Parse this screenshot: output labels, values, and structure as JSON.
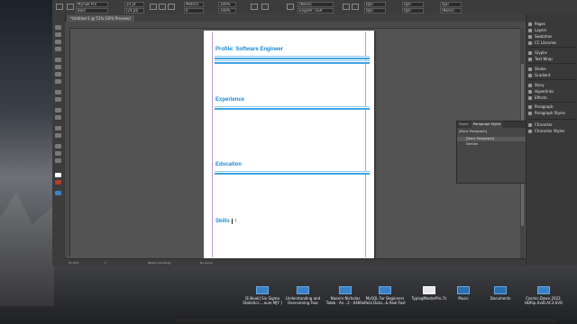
{
  "app": {
    "document_tab": "*Untitled-1 @ 51% [GPU Preview]"
  },
  "control_bar": {
    "font_family": "Myriad Pro",
    "font_style": "Bold",
    "font_size": "20 pt",
    "leading": "(24 pt)",
    "kerning": "Metrics",
    "tracking": "0",
    "scale_h": "100%",
    "scale_v": "100%",
    "paragraph_style": "[None]",
    "language": "English: USA",
    "indent_left": "0p0",
    "indent_right": "0p0",
    "space_before": "0p0",
    "space_after": "0p0",
    "baseline_grid": "[None]"
  },
  "document": {
    "sections": [
      {
        "title": "Profile: Software Engineer"
      },
      {
        "title": "Experience"
      },
      {
        "title": "Education"
      },
      {
        "title": "Skills"
      }
    ],
    "accent_color": "#1a88d0",
    "rule_color": "#3ea3e3"
  },
  "status_bar": {
    "zoom": "51.19%",
    "page": "1",
    "style_mode": "[Basic] (working)",
    "preflight": "No errors"
  },
  "paragraph_styles_panel": {
    "tabs": [
      "Pages",
      "Paragraph Styles"
    ],
    "group_label": "[Basic Paragraph]",
    "items": [
      "[Basic Paragraph]",
      "Section"
    ]
  },
  "dock_panels": [
    {
      "label": "Pages",
      "icon": "pages-icon"
    },
    {
      "label": "Layers",
      "icon": "layers-icon"
    },
    {
      "label": "Swatches",
      "icon": "swatches-icon"
    },
    {
      "label": "CC Libraries",
      "icon": "cc-libraries-icon"
    },
    {
      "label": "Glyphs",
      "icon": "glyphs-icon"
    },
    {
      "label": "Text Wrap",
      "icon": "text-wrap-icon"
    },
    {
      "label": "Stroke",
      "icon": "stroke-icon"
    },
    {
      "label": "Gradient",
      "icon": "gradient-icon"
    },
    {
      "label": "Story",
      "icon": "story-icon"
    },
    {
      "label": "Hyperlinks",
      "icon": "hyperlinks-icon"
    },
    {
      "label": "Effects",
      "icon": "effects-icon"
    },
    {
      "label": "Paragraph",
      "icon": "paragraph-icon"
    },
    {
      "label": "Paragraph Styles",
      "icon": "paragraph-styles-icon"
    },
    {
      "label": "Character",
      "icon": "character-icon"
    },
    {
      "label": "Character Styles",
      "icon": "character-styles-icon"
    }
  ],
  "taskbar": [
    {
      "line1": "[E-Book] Six Sigma",
      "line2": "Statistics....aum MJY ]"
    },
    {
      "line1": "Understanding and",
      "line2": "Overcoming Fear"
    },
    {
      "line1": "Nassim Nicholas",
      "line2": "Taleb - An...2 - 6466e"
    },
    {
      "line1": "MySQL For Beginners",
      "line2": "Real Data...& Real Fast"
    },
    {
      "line1": "TypingMasterPro.7z",
      "line2": ""
    },
    {
      "line1": "Music",
      "line2": ""
    },
    {
      "line1": "Documents",
      "line2": ""
    },
    {
      "line1": "Cosmic.Dawn.2022.",
      "line2": "HDRip.XviD.AC3-EVO"
    }
  ]
}
